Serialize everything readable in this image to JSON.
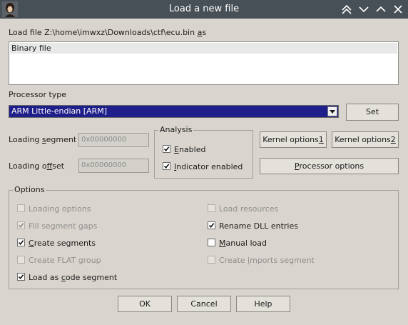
{
  "window": {
    "title": "Load a new file"
  },
  "load_file": {
    "prefix": "Load file ",
    "path": "Z:\\home\\imwxz\\Downloads\\ctf\\ecu.bin",
    "as_pre": " ",
    "as_ul": "a",
    "as_post": "s"
  },
  "file_types": [
    "Binary file"
  ],
  "processor": {
    "label": "Processor type",
    "selected": "ARM Little-endian [ARM]",
    "set_label": "Set"
  },
  "loading_segment": {
    "pre": "Loading ",
    "ul": "s",
    "post": "egment",
    "value": "0x00000000"
  },
  "loading_offset": {
    "pre": "Loading o",
    "ul": "f",
    "post": "fset",
    "value": "0x00000000"
  },
  "analysis": {
    "title": "Analysis",
    "enabled": {
      "ul": "E",
      "post": "nabled",
      "checked": true
    },
    "indicator": {
      "ul": "I",
      "post": "ndicator enabled",
      "checked": true
    }
  },
  "buttons": {
    "kernel1": {
      "pre": "Kernel options ",
      "ul": "1"
    },
    "kernel2": {
      "pre": "Kernel options ",
      "ul": "2"
    },
    "processor_options": {
      "pre": "",
      "ul": "P",
      "post": "rocessor options"
    },
    "ok": "OK",
    "cancel": "Cancel",
    "help": "Help"
  },
  "options": {
    "title": "Options",
    "loading_options": {
      "text": "Loading options",
      "checked": false,
      "enabled": false
    },
    "fill_segment_gaps": {
      "text": "Fill segment gaps",
      "checked": true,
      "enabled": false
    },
    "create_segments": {
      "pre": "",
      "ul": "C",
      "post": "reate segments",
      "checked": true,
      "enabled": true
    },
    "create_flat_group": {
      "text": "Create FLAT group",
      "checked": false,
      "enabled": false
    },
    "load_as_code": {
      "pre": "Load as ",
      "ul": "c",
      "post": "ode segment",
      "checked": true,
      "enabled": true
    },
    "load_resources": {
      "text": "Load resources",
      "checked": false,
      "enabled": false
    },
    "rename_dll": {
      "text": "Rename DLL entries",
      "checked": true,
      "enabled": true
    },
    "manual_load": {
      "pre": "",
      "ul": "M",
      "post": "anual load",
      "checked": false,
      "enabled": true
    },
    "create_imports": {
      "pre": "Create ",
      "ul": "i",
      "post": "mports segment",
      "checked": false,
      "enabled": false
    }
  },
  "colors": {
    "titlebar": "#475057",
    "dialog_bg": "#d9d5ce",
    "selection": "#1f1f8b"
  },
  "icons": [
    "app-avatar-icon",
    "keep-above-icon",
    "minimize-icon",
    "maximize-icon",
    "close-icon"
  ]
}
